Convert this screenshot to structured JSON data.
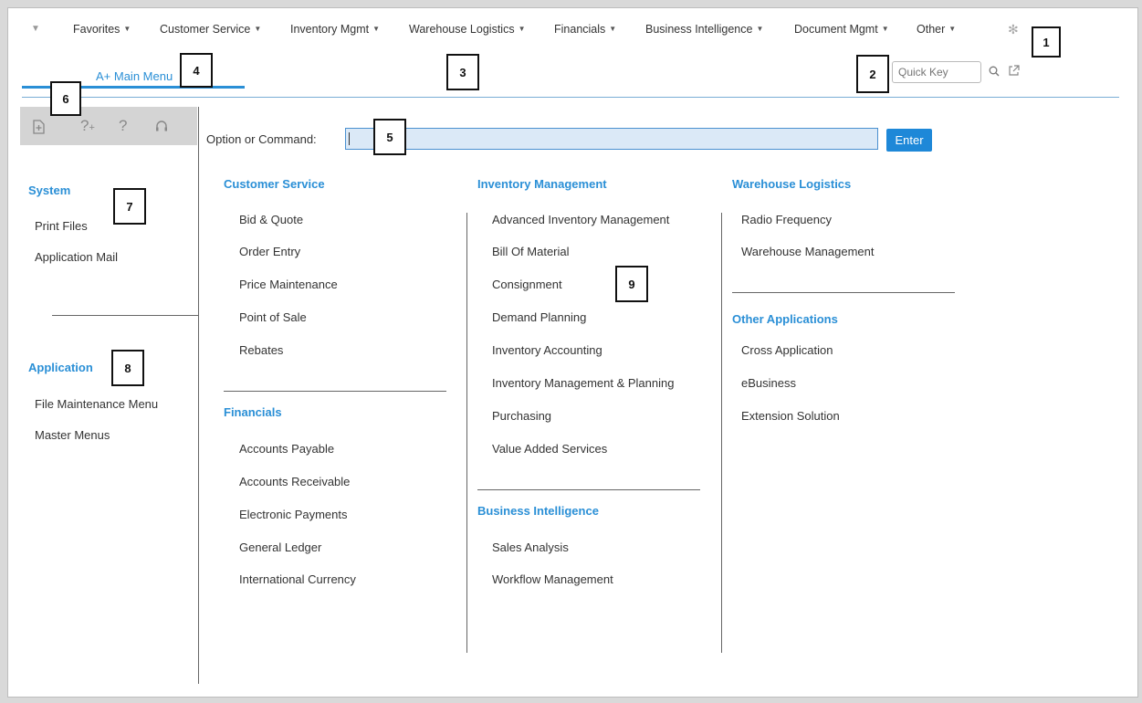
{
  "nav": {
    "dropdown_icon": "caret-down-icon",
    "favorites": "Favorites",
    "customer_service": "Customer Service",
    "inventory_mgmt": "Inventory Mgmt",
    "warehouse_logistics": "Warehouse Logistics",
    "financials": "Financials",
    "business_intelligence": "Business Intelligence",
    "document_mgmt": "Document Mgmt",
    "other": "Other",
    "settings_icon": "gear-icon"
  },
  "tab": {
    "label": "A+ Main Menu"
  },
  "quick_key": {
    "placeholder": "Quick Key",
    "search_icon": "search-icon",
    "export_icon": "external-link-icon"
  },
  "command": {
    "label": "Option or Command:",
    "value": "",
    "enter_label": "Enter"
  },
  "toolbar_icons": [
    "add-document-icon",
    "help-plus-icon",
    "help-icon",
    "support-headset-icon"
  ],
  "sidebar": {
    "system": {
      "heading": "System",
      "items": [
        "Print Files",
        "Application Mail"
      ]
    },
    "application": {
      "heading": "Application",
      "items": [
        "File Maintenance Menu",
        "Master Menus"
      ]
    }
  },
  "menus": {
    "customer_service": {
      "heading": "Customer Service",
      "items": [
        "Bid & Quote",
        "Order Entry",
        "Price Maintenance",
        "Point of Sale",
        "Rebates"
      ]
    },
    "financials": {
      "heading": "Financials",
      "items": [
        "Accounts Payable",
        "Accounts Receivable",
        "Electronic Payments",
        "General Ledger",
        "International Currency"
      ]
    },
    "inventory_management": {
      "heading": "Inventory Management",
      "items": [
        "Advanced Inventory Management",
        "Bill Of Material",
        "Consignment",
        "Demand Planning",
        "Inventory Accounting",
        "Inventory Management & Planning",
        "Purchasing",
        "Value Added Services"
      ]
    },
    "business_intelligence": {
      "heading": "Business Intelligence",
      "items": [
        "Sales Analysis",
        "Workflow Management"
      ]
    },
    "warehouse_logistics": {
      "heading": "Warehouse Logistics",
      "items": [
        "Radio Frequency",
        "Warehouse Management"
      ]
    },
    "other_applications": {
      "heading": "Other Applications",
      "items": [
        "Cross Application",
        "eBusiness",
        "Extension Solution"
      ]
    }
  },
  "callouts": [
    "1",
    "2",
    "3",
    "4",
    "5",
    "6",
    "7",
    "8",
    "9"
  ],
  "colors": {
    "link_blue": "#2a8fd6",
    "enter_button": "#1e88d8",
    "input_fill": "#dbe9f7"
  }
}
